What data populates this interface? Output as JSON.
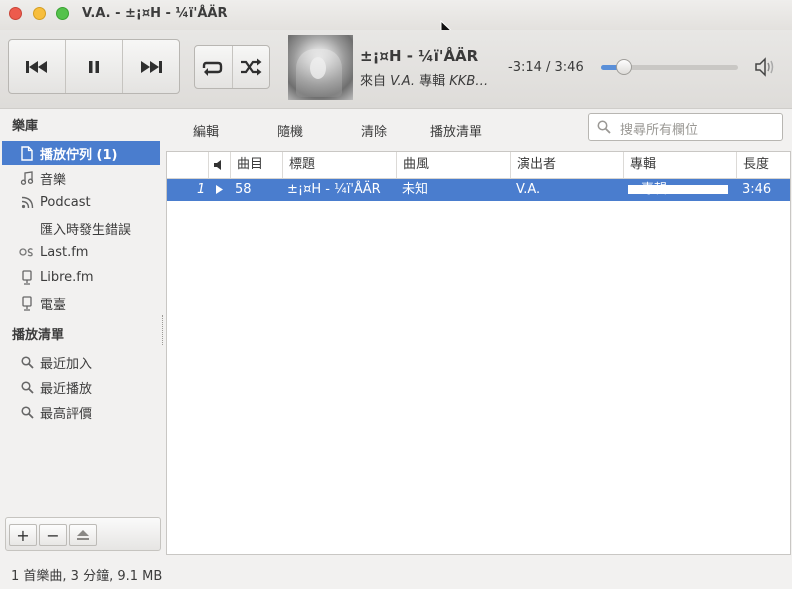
{
  "window": {
    "title": "V.A. - ±¡¤H - ¼ï'ÅÄR"
  },
  "now_playing": {
    "title": "±¡¤H - ¼ï'ÅÄR",
    "from_label": "來自",
    "artist": "V.A.",
    "album_label": "專輯",
    "album": "KKB…",
    "time": "-3:14 / 3:46",
    "progress_fraction": 0.17
  },
  "sidebar": {
    "library_header": "樂庫",
    "library_items": [
      {
        "label": "播放佇列 (1)",
        "icon": "document-icon",
        "selected": true
      },
      {
        "label": "音樂",
        "icon": "music-note-icon",
        "selected": false
      },
      {
        "label": "Podcast",
        "icon": "rss-icon",
        "selected": false
      },
      {
        "label": "匯入時發生錯誤",
        "icon": "",
        "selected": false
      },
      {
        "label": "Last.fm",
        "icon": "lastfm-icon",
        "selected": false
      },
      {
        "label": "Libre.fm",
        "icon": "device-icon",
        "selected": false
      },
      {
        "label": "電臺",
        "icon": "radio-icon",
        "selected": false
      }
    ],
    "playlists_header": "播放清單",
    "playlist_items": [
      {
        "label": "最近加入",
        "icon": "search-icon"
      },
      {
        "label": "最近播放",
        "icon": "search-icon"
      },
      {
        "label": "最高評價",
        "icon": "search-icon"
      }
    ],
    "footer": {
      "add": "+",
      "remove": "−"
    }
  },
  "main_toolbar": {
    "edit": "編輯",
    "shuffle": "隨機",
    "clear": "清除",
    "playlist": "播放清單",
    "search_placeholder": "搜尋所有欄位"
  },
  "table": {
    "columns": [
      "曲目",
      "標題",
      "曲風",
      "演出者",
      "專輯",
      "長度"
    ],
    "rows": [
      {
        "index": "1",
        "track": "58",
        "title": "±¡¤H - ¼ï'ÅÄR",
        "genre": "未知",
        "artist": "V.A.",
        "album": "…專輯…",
        "length": "3:46"
      }
    ]
  },
  "status": "1 首樂曲, 3 分鐘, 9.1 MB"
}
